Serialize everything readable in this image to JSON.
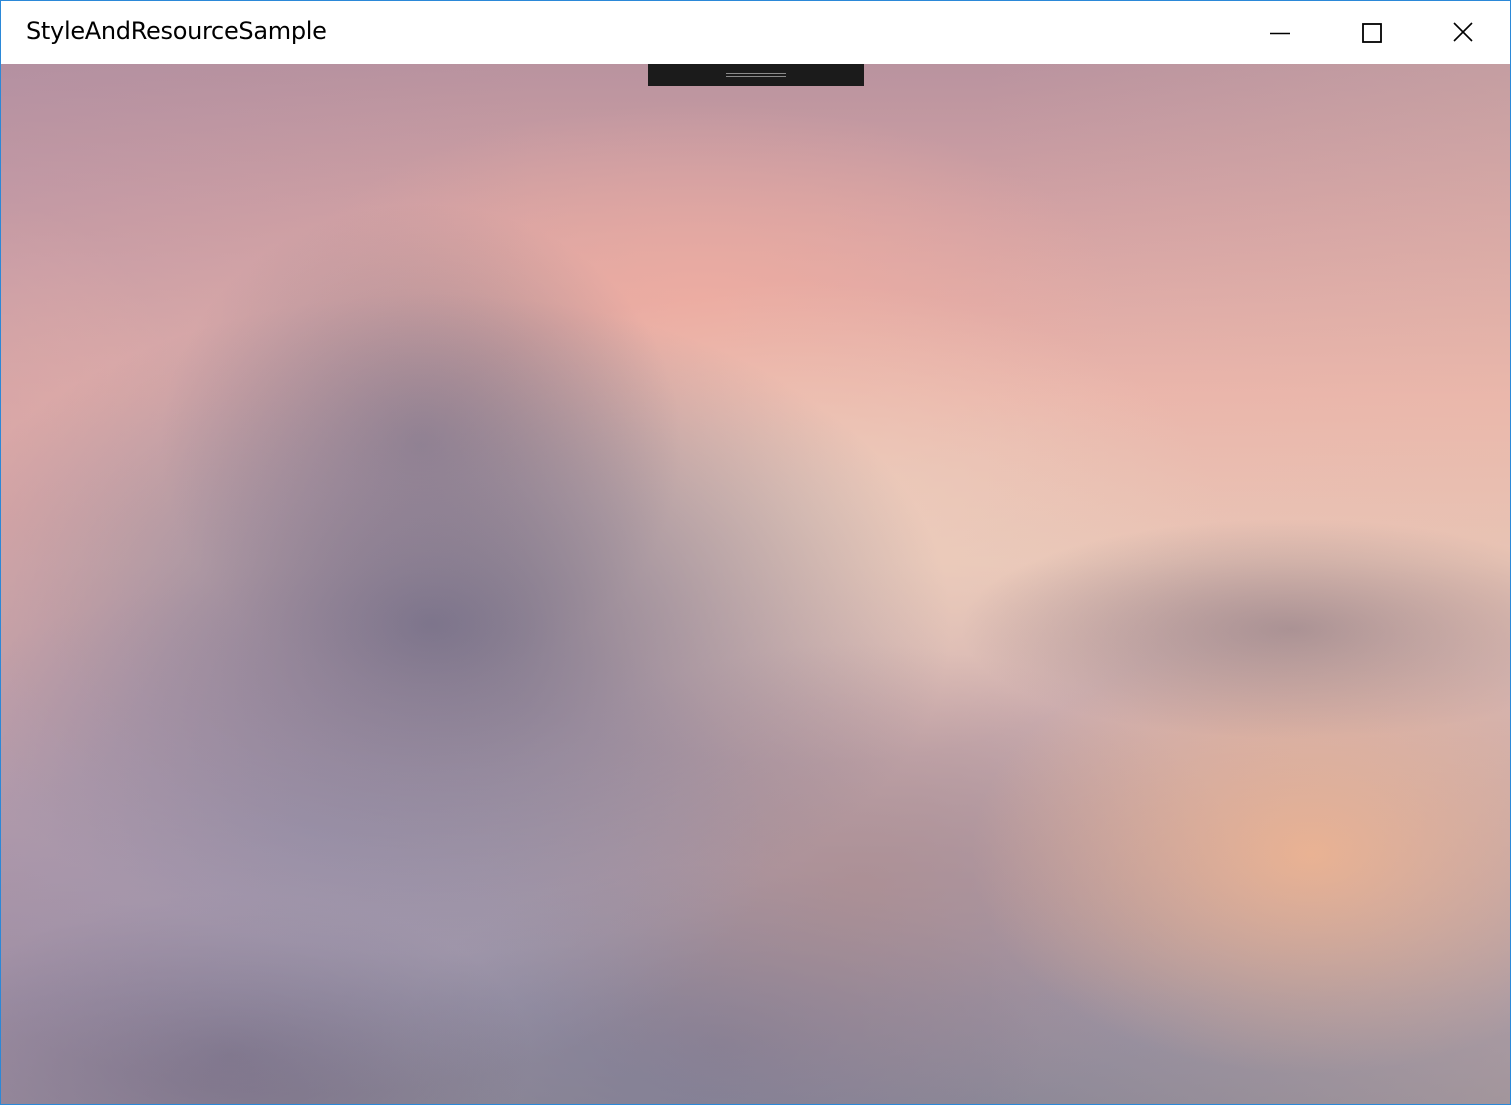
{
  "window": {
    "title": "StyleAndResourceSample",
    "accent_border_color": "#2b88d8"
  },
  "caption_buttons": {
    "minimize_icon": "minimize-icon",
    "maximize_icon": "maximize-icon",
    "close_icon": "close-icon"
  },
  "content": {
    "background": "blurred-landscape-wallpaper",
    "drag_handle": "grip-handle"
  }
}
